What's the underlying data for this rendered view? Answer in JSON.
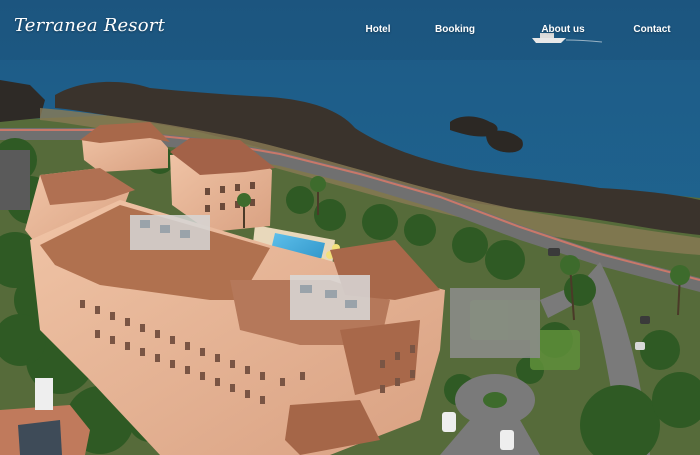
{
  "site": {
    "brand": "Terranea Resort"
  },
  "nav": {
    "items": [
      {
        "id": "hotel",
        "label": "Hotel"
      },
      {
        "id": "booking",
        "label": "Booking"
      },
      {
        "id": "about",
        "label": "About us"
      },
      {
        "id": "contact",
        "label": "Contact"
      }
    ]
  },
  "colors": {
    "ocean": "#1f5f8c",
    "coast_rock": "#3a332c",
    "building_wall": "#e8b89a",
    "roof": "#a8684a",
    "pool": "#3fa5d6",
    "foliage": "#3d6b2c",
    "road": "#6f6f6f",
    "nav_text": "#ffffff"
  }
}
